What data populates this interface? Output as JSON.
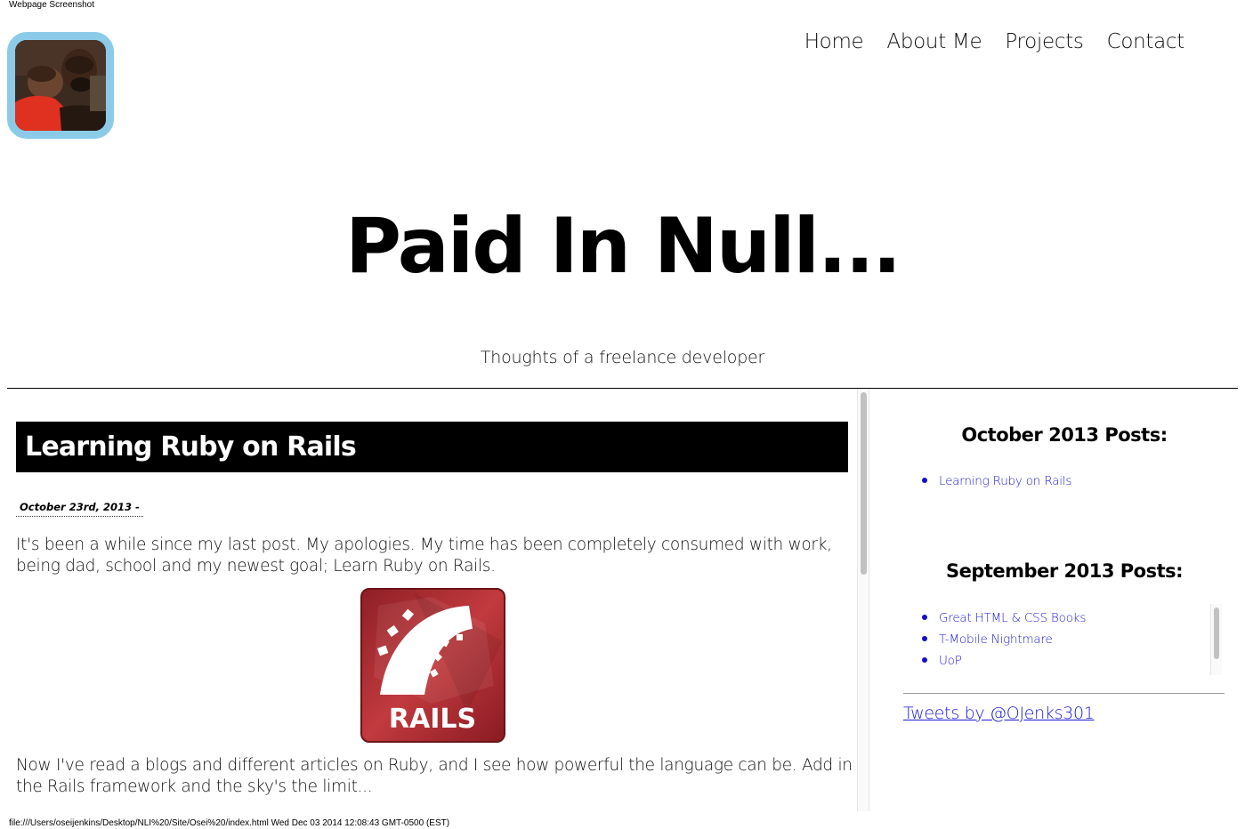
{
  "capture": {
    "label": "Webpage Screenshot",
    "footer": "file:///Users/oseijenkins/Desktop/NLI%20/Site/Osei%20/index.html Wed Dec 03 2014 12:08:43 GMT-0500 (EST)"
  },
  "nav": {
    "items": [
      {
        "label": "Home"
      },
      {
        "label": "About Me"
      },
      {
        "label": "Projects"
      },
      {
        "label": "Contact"
      }
    ]
  },
  "header": {
    "title": "Paid In Null...",
    "tagline": "Thoughts of a freelance developer"
  },
  "post": {
    "title": "Learning Ruby on Rails",
    "date": "October 23rd, 2013 -",
    "paragraph1": "It's been a while since my last post. My apologies. My time has been completely consumed with work, being dad, school and my newest goal; Learn Ruby on Rails.",
    "paragraph2": "Now I've read a blogs and different articles on Ruby, and I see how powerful the language can be. Add in the Rails framework and the sky's the limit...",
    "logo_text": "RAILS"
  },
  "sidebar": {
    "october_heading": "October 2013 Posts:",
    "october_posts": [
      {
        "label": "Learning Ruby on Rails"
      }
    ],
    "september_heading": "September 2013 Posts:",
    "september_posts": [
      {
        "label": "Great HTML & CSS Books"
      },
      {
        "label": "T-Mobile Nightmare"
      },
      {
        "label": "UoP"
      }
    ],
    "tweets_link": "Tweets by @OJenks301"
  },
  "colors": {
    "avatar_border": "#8bcbe8",
    "link": "#1a1ad8",
    "rails_red": "#b3262d"
  }
}
